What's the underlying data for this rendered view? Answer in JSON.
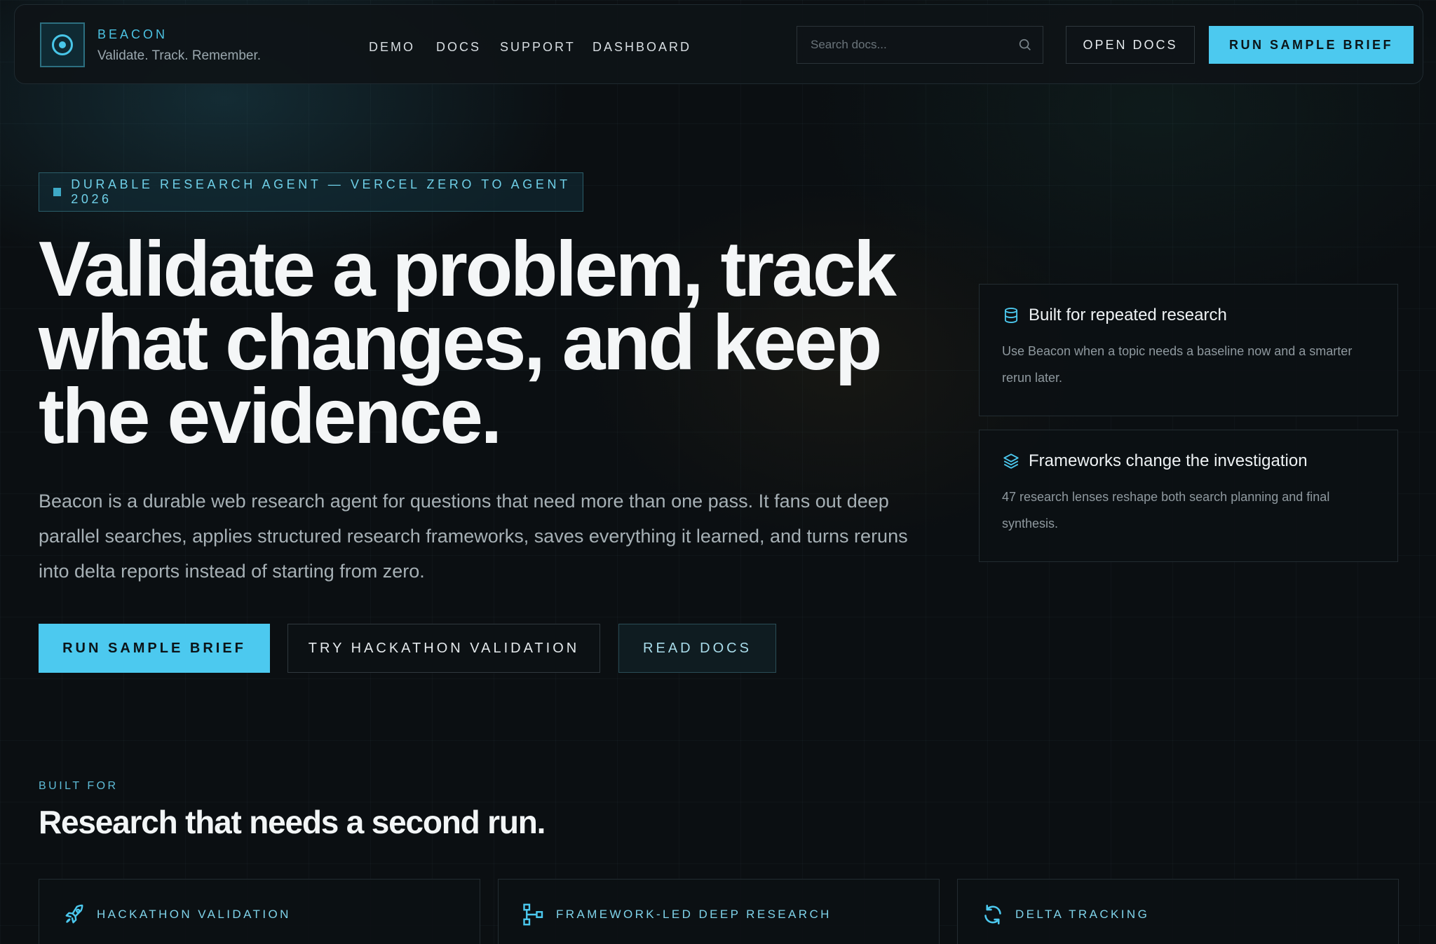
{
  "brand": {
    "name": "BEACON",
    "tagline": "Validate. Track. Remember."
  },
  "nav": {
    "links": [
      "DEMO",
      "DOCS",
      "SUPPORT",
      "DASHBOARD"
    ],
    "search_placeholder": "Search docs...",
    "open_docs_label": "OPEN DOCS",
    "run_brief_label": "RUN SAMPLE BRIEF"
  },
  "hero": {
    "eyebrow": "DURABLE RESEARCH AGENT — VERCEL ZERO TO AGENT 2026",
    "title_lines": [
      "Validate a problem, track",
      "what changes, and keep",
      "the evidence."
    ],
    "lead": "Beacon is a durable web research agent for questions that need more than one pass. It fans out deep parallel searches, applies structured research frameworks, saves everything it learned, and turns reruns into delta reports instead of starting from zero.",
    "primary_cta": "RUN SAMPLE BRIEF",
    "secondary_cta": "TRY HACKATHON VALIDATION",
    "tertiary_cta": "READ DOCS"
  },
  "side_cards": [
    {
      "icon": "database-icon",
      "title": "Built for repeated research",
      "body": "Use Beacon when a topic needs a baseline now and a smarter rerun later."
    },
    {
      "icon": "layers-icon",
      "title": "Frameworks change the investigation",
      "body": "47 research lenses reshape both search planning and final synthesis."
    }
  ],
  "built_for": {
    "eyebrow": "BUILT FOR",
    "title": "Research that needs a second run.",
    "features": [
      {
        "icon": "rocket-icon",
        "label": "HACKATHON VALIDATION"
      },
      {
        "icon": "hierarchy-icon",
        "label": "FRAMEWORK-LED DEEP RESEARCH"
      },
      {
        "icon": "refresh-icon",
        "label": "DELTA TRACKING"
      }
    ]
  },
  "colors": {
    "accent": "#4cc9ef",
    "background": "#0b0f12",
    "text": "#f4f6f7"
  }
}
